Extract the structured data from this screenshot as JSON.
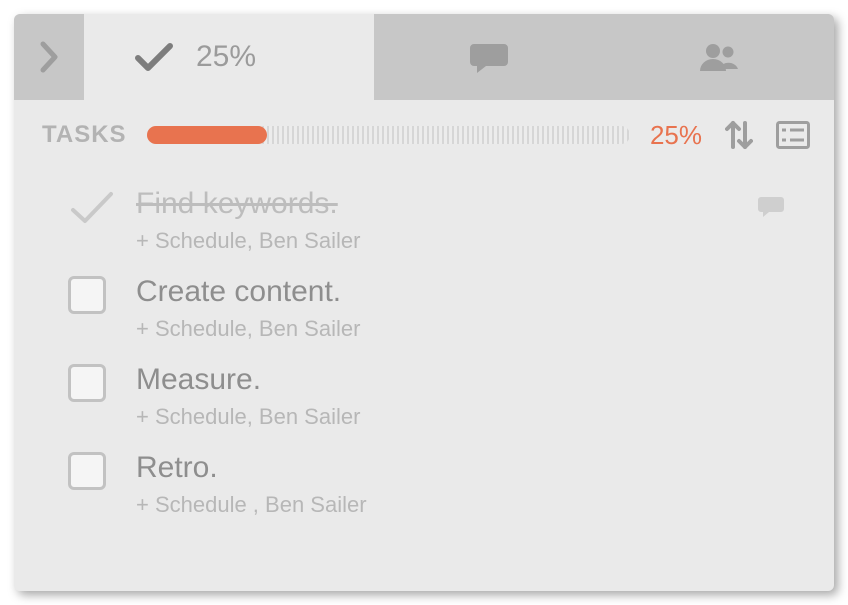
{
  "colors": {
    "accent": "#e8734f"
  },
  "tabs": {
    "progress_pct_label": "25%"
  },
  "header": {
    "label": "TASKS",
    "progress_pct": 25,
    "progress_pct_label": "25%"
  },
  "tasks": [
    {
      "done": true,
      "title": "Find keywords.",
      "subtitle": "+ Schedule,   Ben Sailer",
      "has_comment": true
    },
    {
      "done": false,
      "title": "Create content.",
      "subtitle": "+ Schedule,   Ben Sailer",
      "has_comment": false
    },
    {
      "done": false,
      "title": "Measure.",
      "subtitle": "+ Schedule,   Ben Sailer",
      "has_comment": false
    },
    {
      "done": false,
      "title": "Retro.",
      "subtitle": "+ Schedule ,   Ben Sailer",
      "has_comment": false
    }
  ]
}
